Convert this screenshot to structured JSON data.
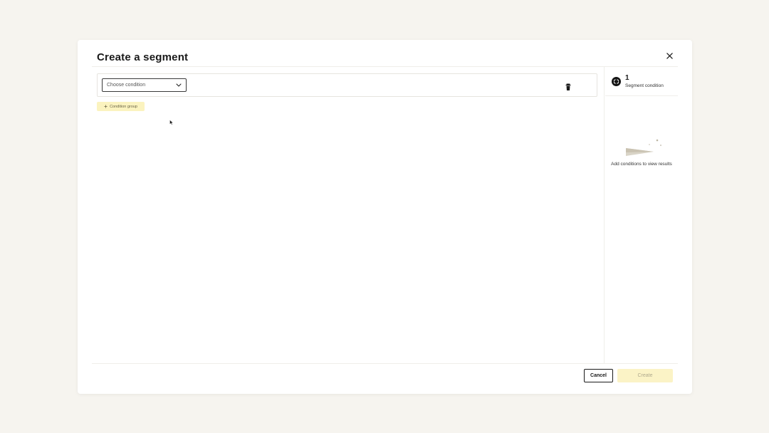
{
  "modal": {
    "title": "Create a segment"
  },
  "condition": {
    "select_placeholder": "Choose condition"
  },
  "actions": {
    "add_group_label": "Condition group"
  },
  "summary": {
    "count": "1",
    "label": "Segment condition",
    "empty_text": "Add conditions to view results"
  },
  "footer": {
    "cancel_label": "Cancel",
    "create_label": "Create"
  },
  "icons": {
    "close": "close-icon",
    "chevron": "chevron-down-icon",
    "trash": "trash-icon",
    "plus": "plus-icon",
    "segment": "segment-icon"
  },
  "colors": {
    "background": "#f6f4ef",
    "accent_yellow": "#fbf3bf",
    "dark": "#141414"
  }
}
